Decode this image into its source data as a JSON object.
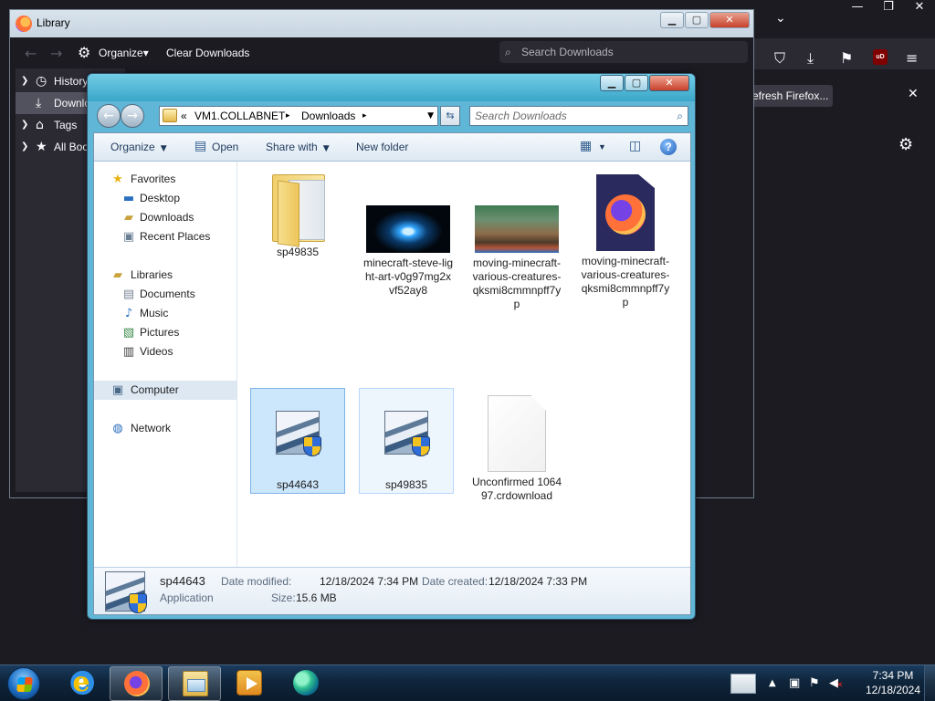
{
  "firefox": {
    "window_controls": [
      "—",
      "❐",
      "✕"
    ],
    "toolbar_icons": [
      "pocket-icon",
      "downloads-icon",
      "extensions-icon",
      "ublock-icon",
      "menu-icon"
    ],
    "ublock_label": "uD",
    "notification_button": "efresh Firefox...",
    "notification_close": "✕"
  },
  "library": {
    "title": "Library",
    "toolbar": {
      "organize_label": "Organize",
      "organize_caret": "▾",
      "clear_downloads_label": "Clear Downloads"
    },
    "search_placeholder": "Search Downloads",
    "tree": [
      {
        "label": "History",
        "icon": "clock-icon",
        "expandable": true
      },
      {
        "label": "Downloads",
        "icon": "download-icon",
        "expandable": false,
        "selected": true
      },
      {
        "label": "Tags",
        "icon": "tag-icon",
        "expandable": true
      },
      {
        "label": "All Bookmarks",
        "icon": "star-icon",
        "expandable": true
      }
    ]
  },
  "explorer": {
    "address": {
      "overflow": "«",
      "crumbs": [
        "VM1.COLLABNET",
        "Downloads"
      ],
      "separator": "▸"
    },
    "search_placeholder": "Search Downloads",
    "commands": {
      "organize": "Organize",
      "open": "Open",
      "share_with": "Share with",
      "new_folder": "New folder",
      "help": "?"
    },
    "nav": {
      "favorites_header": "Favorites",
      "favorites": [
        "Desktop",
        "Downloads",
        "Recent Places"
      ],
      "libraries_header": "Libraries",
      "libraries": [
        "Documents",
        "Music",
        "Pictures",
        "Videos"
      ],
      "computer": "Computer",
      "network": "Network"
    },
    "files": [
      {
        "name": "sp49835",
        "kind": "folder"
      },
      {
        "name": "minecraft-steve-light-art-v0g97mg2xvf52ay8",
        "kind": "image"
      },
      {
        "name": "moving-minecraft-various-creatures-qksmi8cmmnpff7yp",
        "kind": "image"
      },
      {
        "name": "moving-minecraft-various-creatures-qksmi8cmmnpff7yp",
        "kind": "firefox-document"
      },
      {
        "name": "sp44643",
        "kind": "setup-application",
        "state": "selected"
      },
      {
        "name": "sp49835",
        "kind": "setup-application",
        "state": "hover"
      },
      {
        "name": "Unconfirmed 106497.crdownload",
        "kind": "blank-document"
      }
    ],
    "details": {
      "name": "sp44643",
      "type": "Application",
      "date_modified_label": "Date modified:",
      "date_modified": "12/18/2024 7:34 PM",
      "date_created_label": "Date created:",
      "date_created": "12/18/2024 7:33 PM",
      "size_label": "Size:",
      "size": "15.6 MB"
    }
  },
  "taskbar": {
    "pinned": [
      "internet-explorer-icon",
      "firefox-icon",
      "windows-explorer-icon",
      "windows-media-player-icon",
      "edge-icon"
    ],
    "clock_time": "7:34 PM",
    "clock_date": "12/18/2024"
  }
}
